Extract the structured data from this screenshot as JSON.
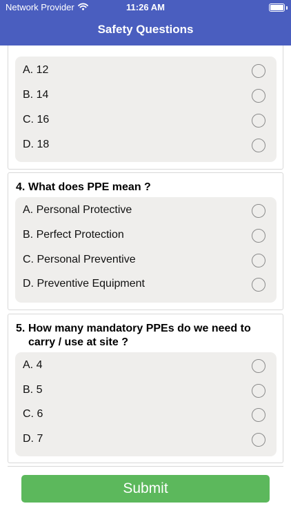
{
  "status_bar": {
    "carrier": "Network Provider",
    "time": "11:26 AM"
  },
  "header": {
    "title": "Safety Questions"
  },
  "questions": [
    {
      "number": "",
      "text": "",
      "options": [
        {
          "label": "A. 12"
        },
        {
          "label": "B. 14"
        },
        {
          "label": "C. 16"
        },
        {
          "label": "D. 18"
        }
      ]
    },
    {
      "number": "4.",
      "text": "What does PPE mean ?",
      "options": [
        {
          "label": "A. Personal Protective"
        },
        {
          "label": "B. Perfect Protection"
        },
        {
          "label": "C. Personal Preventive"
        },
        {
          "label": "D. Preventive Equipment"
        }
      ]
    },
    {
      "number": "5.",
      "text": "How many mandatory PPEs do we need to carry / use at site ?",
      "options": [
        {
          "label": "A. 4"
        },
        {
          "label": "B. 5"
        },
        {
          "label": "C. 6"
        },
        {
          "label": "D. 7"
        }
      ]
    }
  ],
  "submit_label": "Submit",
  "colors": {
    "header": "#4a5ebf",
    "submit": "#5cb85c",
    "option_panel": "#efeeec"
  },
  "icons": {
    "wifi": "wifi-icon",
    "battery": "battery-icon",
    "radio": "radio-unselected-icon"
  }
}
